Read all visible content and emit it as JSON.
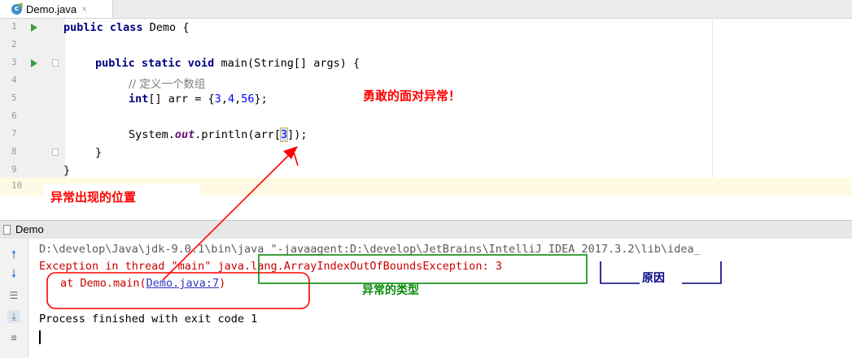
{
  "tab": {
    "label": "Demo.java",
    "close": "×"
  },
  "editor": {
    "line_numbers": [
      "1",
      "2",
      "3",
      "4",
      "5",
      "6",
      "7",
      "8",
      "9",
      "10"
    ],
    "lines": {
      "l1": {
        "kw": "public class",
        "rest": " Demo {"
      },
      "l3": {
        "kw": "public static void",
        "rest": " main(String[] args) {"
      },
      "l4": {
        "comment": "// 定义一个数组"
      },
      "l5": {
        "kw": "int",
        "pre": "[] arr = {",
        "n1": "3",
        "c1": ",",
        "n2": "4",
        "c2": ",",
        "n3": "56",
        "end": "};"
      },
      "l7": {
        "pre": "System.",
        "field": "out",
        "mid": ".println(arr[",
        "idx": "3",
        "end": "]);"
      },
      "l8": {
        "text": "}"
      },
      "l9": {
        "text": "}"
      }
    }
  },
  "annotations": {
    "face_exception": "勇敢的面对异常！",
    "location": "异常出现的位置",
    "type": "异常的类型",
    "reason": "原因"
  },
  "panel": {
    "title": "Demo"
  },
  "console": {
    "cmd": "D:\\develop\\Java\\jdk-9.0.1\\bin\\java \"-javaagent:D:\\develop\\JetBrains\\IntelliJ IDEA 2017.3.2\\lib\\idea_",
    "exc_prefix": "Exception in thread \"main\" ",
    "exc_class": "java.lang.ArrayIndexOutOfBoundsException",
    "exc_msg": ": 3",
    "at_prefix": "at Demo.main(",
    "at_link": "Demo.java:7",
    "at_suffix": ")",
    "finished": "Process finished with exit code 1"
  },
  "colors": {
    "annotation_red": "#ff0000",
    "annotation_green": "#0a8a0a",
    "annotation_navy": "#000080",
    "error_text": "#c80000"
  }
}
